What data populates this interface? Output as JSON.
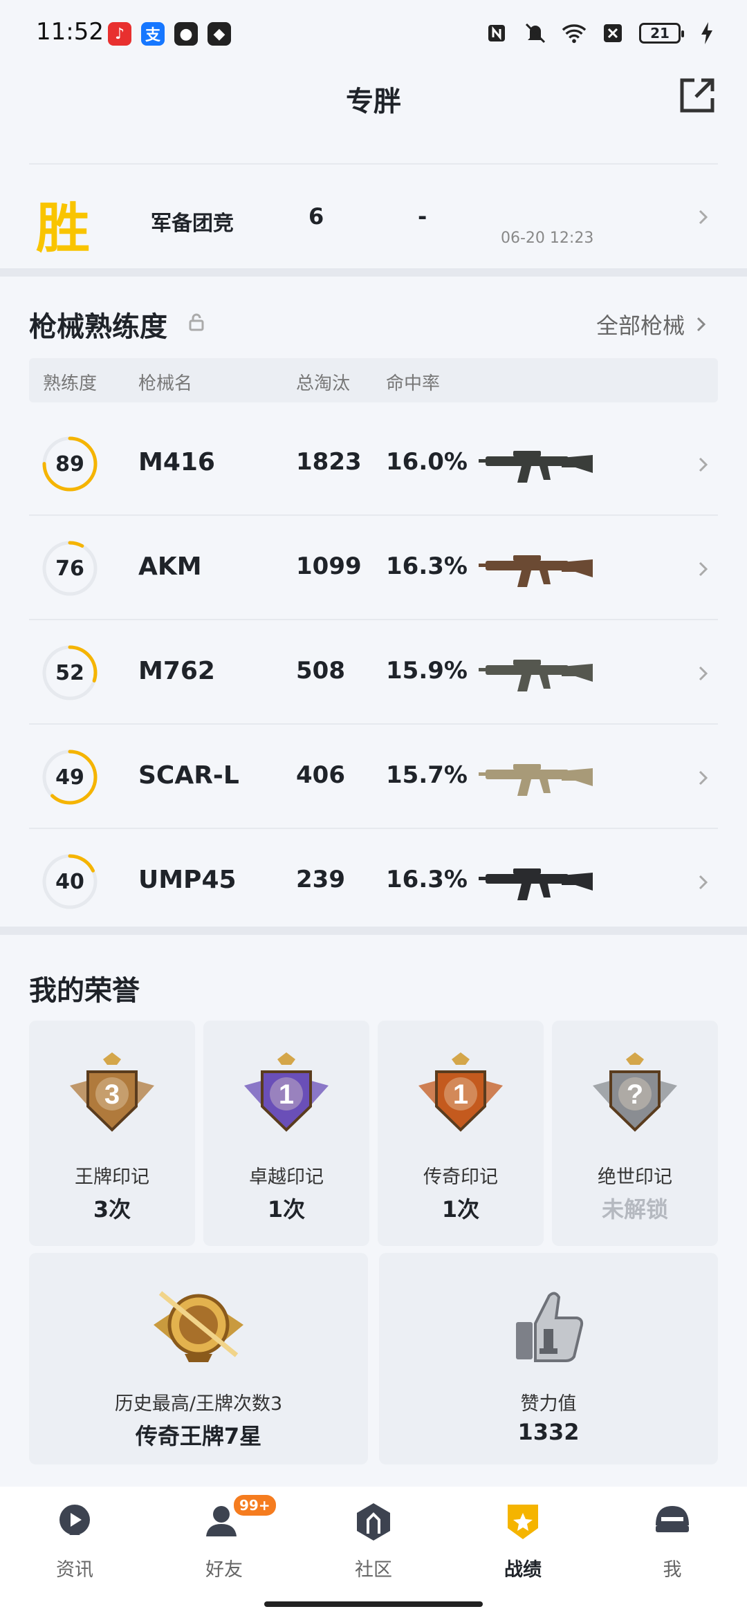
{
  "status_bar": {
    "time": "11:52",
    "battery": "21"
  },
  "header": {
    "title": "专胖"
  },
  "last_match": {
    "result": "胜",
    "mode": "军备团竞",
    "kills": "6",
    "rank": "-",
    "time": "06-20 12:23"
  },
  "weapons": {
    "title": "枪械熟练度",
    "all_link": "全部枪械",
    "columns": [
      "熟练度",
      "枪械名",
      "总淘汰",
      "命中率"
    ],
    "rows": [
      {
        "mastery": "89",
        "mastery_pct": 0.75,
        "name": "M416",
        "kills": "1823",
        "accuracy": "16.0%",
        "gun_color": "#3a3d3a"
      },
      {
        "mastery": "76",
        "mastery_pct": 0.08,
        "name": "AKM",
        "kills": "1099",
        "accuracy": "16.3%",
        "gun_color": "#6b4a33"
      },
      {
        "mastery": "52",
        "mastery_pct": 0.3,
        "name": "M762",
        "kills": "508",
        "accuracy": "15.9%",
        "gun_color": "#55574f"
      },
      {
        "mastery": "49",
        "mastery_pct": 0.62,
        "name": "SCAR-L",
        "kills": "406",
        "accuracy": "15.7%",
        "gun_color": "#a89a78"
      },
      {
        "mastery": "40",
        "mastery_pct": 0.18,
        "name": "UMP45",
        "kills": "239",
        "accuracy": "16.3%",
        "gun_color": "#2a2b2e"
      }
    ]
  },
  "honors": {
    "title": "我的荣誉",
    "marks": [
      {
        "label": "王牌印记",
        "value": "3次",
        "icon": "ace-mark-badge-icon",
        "badge_text": "3",
        "color": "#b07a3c"
      },
      {
        "label": "卓越印记",
        "value": "1次",
        "icon": "excellence-mark-badge-icon",
        "badge_text": "1",
        "color": "#6a4fb8"
      },
      {
        "label": "传奇印记",
        "value": "1次",
        "icon": "legend-mark-badge-icon",
        "badge_text": "1",
        "color": "#c45a1e"
      },
      {
        "label": "绝世印记",
        "value": "未解锁",
        "icon": "peerless-mark-badge-icon",
        "badge_text": "?",
        "color": "#8a8d92"
      }
    ],
    "best": {
      "label": "历史最高/王牌次数3",
      "value": "传奇王牌7星"
    },
    "likes": {
      "label": "赞力值",
      "value": "1332"
    }
  },
  "nav": {
    "items": [
      {
        "label": "资讯"
      },
      {
        "label": "好友",
        "badge": "99+"
      },
      {
        "label": "社区"
      },
      {
        "label": "战绩",
        "active": true
      },
      {
        "label": "我"
      }
    ]
  },
  "colors": {
    "accent": "#f5b400",
    "win": "#f9c400",
    "badge": "#f57c1f"
  }
}
